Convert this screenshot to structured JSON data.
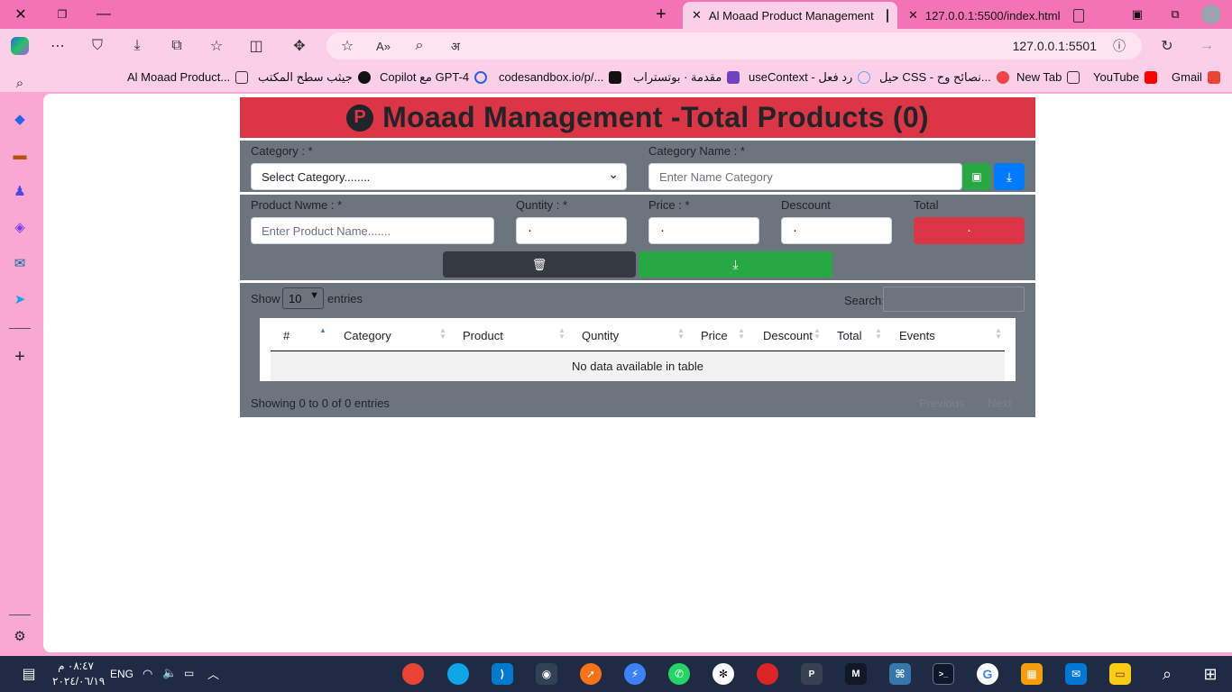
{
  "browser": {
    "tabs": [
      {
        "title": "Al Moaad Product Management",
        "active": true
      },
      {
        "title": "127.0.0.1:5500/index.html",
        "active": false
      }
    ],
    "url": "127.0.0.1:5501",
    "bookmarks": [
      "Al Moaad Product...",
      "جيثب سطح المكتب",
      "Copilot مع GPT-4",
      "codesandbox.io/p/...",
      "مقدمة · بوتستراب",
      "useContext - رد فعل",
      "حيل CSS - نصائح وح...",
      "New Tab",
      "YouTube",
      "Gmail"
    ]
  },
  "app": {
    "logo_letter": "P",
    "title": "Moaad Management -Total Products (0)",
    "category": {
      "label": "Category : *",
      "select_value": "Select Category........"
    },
    "category_name": {
      "label": "Category Name : *",
      "placeholder": "Enter Name Category"
    },
    "product": {
      "name_label": "Product Nwme : *",
      "name_placeholder": "Enter Product Name.......",
      "quantity_label": "Quntity : *",
      "quantity_value": "٠",
      "price_label": "Price : *",
      "price_value": "٠",
      "discount_label": "Descount",
      "discount_value": "٠",
      "total_label": "Total",
      "total_value": "٠"
    },
    "table": {
      "show_label": "Show",
      "entries_value": "10",
      "entries_label": "entries",
      "search_label": "Search:",
      "columns": [
        "#",
        "Category",
        "Product",
        "Quntity",
        "Price",
        "Descount",
        "Total",
        "Events"
      ],
      "empty_message": "No data available in table",
      "info": "Showing 0 to 0 of 0 entries",
      "previous": "Previous",
      "next": "Next"
    }
  },
  "taskbar": {
    "time": "٠٨:٤٧ م",
    "date": "٢٠٢٤/٠٦/١٩",
    "lang": "ENG"
  },
  "colors": {
    "danger": "#dc3545",
    "panel": "#6c757d",
    "success": "#28a745",
    "primary": "#007bff",
    "dark": "#343a40"
  }
}
